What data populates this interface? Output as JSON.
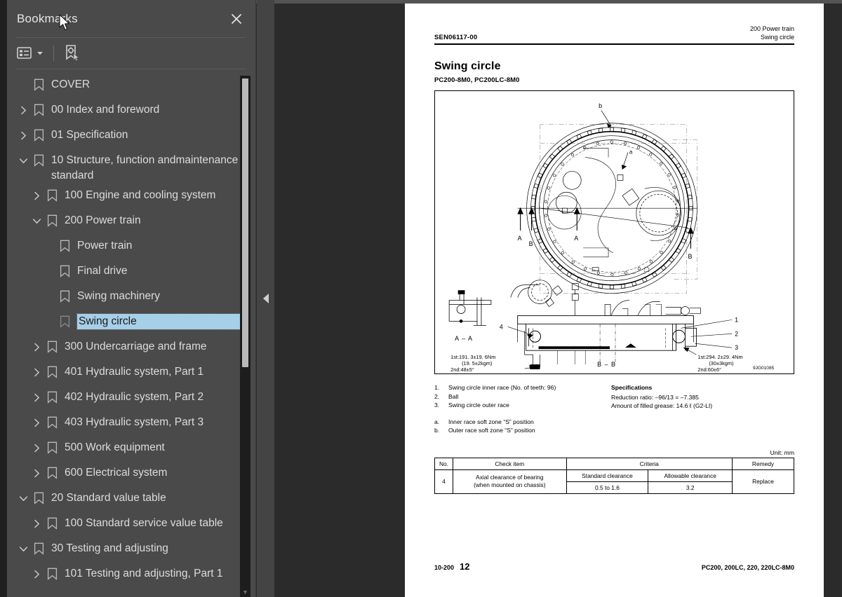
{
  "panel": {
    "title": "Bookmarks",
    "close_icon": "close-icon",
    "toolbar": {
      "options_label": "list-options-icon",
      "new_bookmark_label": "new-bookmark-icon"
    }
  },
  "tree": [
    {
      "label": "COVER",
      "level": 0,
      "twisty": "none",
      "selected": false
    },
    {
      "label": "00 Index and foreword",
      "level": 0,
      "twisty": "collapsed",
      "selected": false
    },
    {
      "label": "01 Specification",
      "level": 0,
      "twisty": "collapsed",
      "selected": false
    },
    {
      "label": "10 Structure, function andmaintenance standard",
      "level": 0,
      "twisty": "expanded",
      "selected": false
    },
    {
      "label": "100 Engine and cooling system",
      "level": 1,
      "twisty": "collapsed",
      "selected": false
    },
    {
      "label": "200 Power train",
      "level": 1,
      "twisty": "expanded",
      "selected": false
    },
    {
      "label": "Power train",
      "level": 2,
      "twisty": "none",
      "selected": false
    },
    {
      "label": "Final drive",
      "level": 2,
      "twisty": "none",
      "selected": false
    },
    {
      "label": "Swing machinery",
      "level": 2,
      "twisty": "none",
      "selected": false
    },
    {
      "label": "Swing circle",
      "level": 2,
      "twisty": "none",
      "selected": true
    },
    {
      "label": "300 Undercarriage and frame",
      "level": 1,
      "twisty": "collapsed",
      "selected": false
    },
    {
      "label": "401 Hydraulic system, Part 1",
      "level": 1,
      "twisty": "collapsed",
      "selected": false
    },
    {
      "label": "402 Hydraulic system, Part 2",
      "level": 1,
      "twisty": "collapsed",
      "selected": false
    },
    {
      "label": "403 Hydraulic system, Part 3",
      "level": 1,
      "twisty": "collapsed",
      "selected": false
    },
    {
      "label": "500 Work equipment",
      "level": 1,
      "twisty": "collapsed",
      "selected": false
    },
    {
      "label": "600 Electrical system",
      "level": 1,
      "twisty": "collapsed",
      "selected": false
    },
    {
      "label": "20 Standard value table",
      "level": 0,
      "twisty": "expanded",
      "selected": false
    },
    {
      "label": "100 Standard service value table",
      "level": 1,
      "twisty": "collapsed",
      "selected": false
    },
    {
      "label": "30 Testing and adjusting",
      "level": 0,
      "twisty": "expanded",
      "selected": false
    },
    {
      "label": "101 Testing and adjusting, Part 1",
      "level": 1,
      "twisty": "collapsed",
      "selected": false
    }
  ],
  "document": {
    "header": {
      "sen": "SEN06117-00",
      "section": "200 Power train",
      "subject": "Swing circle"
    },
    "title": "Swing circle",
    "models": "PC200-8M0, PC200LC-8M0",
    "figure": {
      "drawing_no": "9JG01085",
      "section_aa": "A – A",
      "section_bb": "B – B",
      "marker_a": "A",
      "marker_b": "B",
      "callout_a": "a",
      "callout_b": "b",
      "callouts": [
        "1",
        "2",
        "3",
        "4"
      ],
      "torque_left": [
        "1st:191. 3±19. 6Nm",
        "(19. 5±2kgm)",
        "2nd:48±5°"
      ],
      "torque_right": [
        "1st:294. 2±29. 4Nm",
        "(30±3kgm)",
        "2nd:60±6°"
      ]
    },
    "legend": [
      {
        "num": "1.",
        "text": "Swing circle inner race (No. of teeth: 96)"
      },
      {
        "num": "2.",
        "text": "Ball"
      },
      {
        "num": "3.",
        "text": "Swing circle outer race"
      }
    ],
    "legend_letters": [
      {
        "num": "a.",
        "text": "Inner race soft zone “S” position"
      },
      {
        "num": "b.",
        "text": "Outer race soft zone “S” position"
      }
    ],
    "specifications": {
      "title": "Specifications",
      "lines": [
        "Reduction ratio:  –96/13 = –7.385",
        "Amount of filled grease:  14.6 ℓ (G2-LI)"
      ]
    },
    "table": {
      "unit": "Unit: mm",
      "headers": [
        "No.",
        "Check item",
        "Criteria",
        "Remedy"
      ],
      "sub_headers": [
        "Standard clearance",
        "Allowable clearance"
      ],
      "row": {
        "no": "4",
        "check_item_line1": "Axial clearance of bearing",
        "check_item_line2": "(when mounted on chassis)",
        "standard": "0.5 to 1.6",
        "allowable": "3.2",
        "remedy": "Replace"
      }
    },
    "footer": {
      "section_no": "10-200",
      "page_no": "12",
      "models": "PC200, 200LC, 220, 220LC-8M0"
    }
  },
  "splitter": {
    "collapse_icon": "collapse-left-arrow-icon"
  }
}
